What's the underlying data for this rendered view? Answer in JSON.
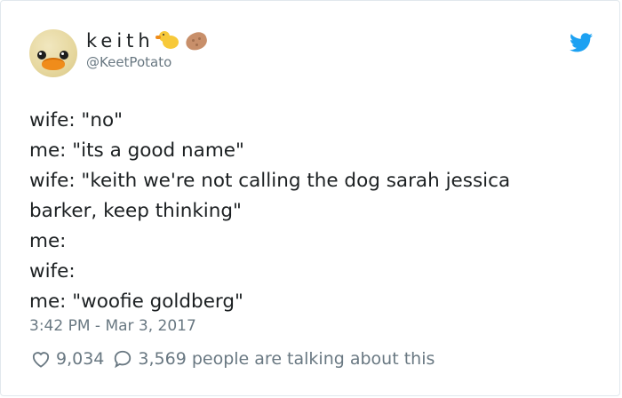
{
  "author": {
    "display_name": "keith",
    "handle": "@KeetPotato",
    "emojis": [
      "chick-emoji",
      "potato-emoji"
    ]
  },
  "tweet": {
    "lines": [
      "wife: \"no\"",
      "me: \"its a good name\"",
      "wife: \"keith we're not calling the dog sarah jessica",
      "barker, keep thinking\"",
      "me:",
      "wife:",
      "me: \"woofie goldberg\""
    ],
    "timestamp": "3:42 PM - Mar 3, 2017"
  },
  "stats": {
    "likes": "9,034",
    "replies": "3,569 people are talking about this"
  },
  "icons": {
    "logo": "twitter-bird-icon",
    "like": "heart-icon",
    "reply": "speech-bubble-icon"
  },
  "colors": {
    "twitter_blue": "#1da1f2",
    "text": "#1c2022",
    "meta": "#697882",
    "border": "#e1e8ed"
  }
}
